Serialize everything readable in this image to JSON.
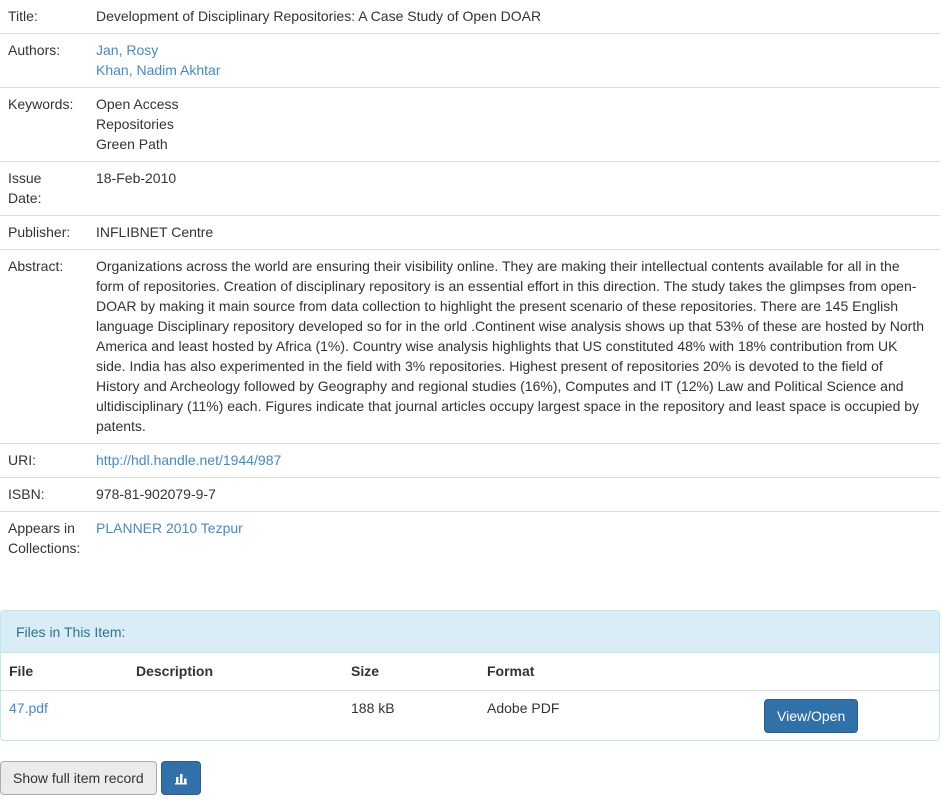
{
  "metadata": {
    "title_label": "Title:",
    "title": "Development of Disciplinary Repositories: A Case Study of Open DOAR",
    "authors_label": "Authors:",
    "authors": [
      "Jan, Rosy",
      "Khan, Nadim Akhtar"
    ],
    "keywords_label": "Keywords:",
    "keywords": [
      "Open Access",
      "Repositories",
      "Green Path"
    ],
    "issue_date_label": [
      "Issue",
      "Date:"
    ],
    "issue_date": "18-Feb-2010",
    "publisher_label": "Publisher:",
    "publisher": "INFLIBNET Centre",
    "abstract_label": "Abstract:",
    "abstract": "Organizations across the world are ensuring their visibility online. They are making their intellectual contents available for all in the form of repositories. Creation of disciplinary repository is an essential effort in this direction. The study takes the glimpses from open-DOAR by making it main source from data collection to highlight the present scenario of these repositories. There are 145 English language Disciplinary repository developed so for in the orld .Continent wise analysis shows up that 53% of these are hosted by North America and least hosted by Africa (1%). Country wise analysis highlights that US constituted 48% with 18% contribution from UK side. India has also experimented in the field with 3% repositories. Highest present of repositories 20% is devoted to the field of History and Archeology followed by Geography and regional studies (16%), Computes and IT (12%) Law and Political Science and ultidisciplinary (11%) each. Figures indicate that journal articles occupy largest space in the repository and least space is occupied by patents.",
    "uri_label": "URI:",
    "uri": "http://hdl.handle.net/1944/987",
    "isbn_label": "ISBN:",
    "isbn": "978-81-902079-9-7",
    "collections_label": [
      "Appears in",
      "Collections:"
    ],
    "collection": "PLANNER 2010 Tezpur"
  },
  "files_panel": {
    "heading": "Files in This Item:",
    "columns": [
      "File",
      "Description",
      "Size",
      "Format"
    ],
    "rows": [
      {
        "file": "47.pdf",
        "description": "",
        "size": "188 kB",
        "format": "Adobe PDF",
        "action": "View/Open"
      }
    ]
  },
  "actions": {
    "full_record_label": "Show full item record",
    "stats_icon": "bar-chart-icon"
  },
  "colors": {
    "link": "#428bca",
    "panel_heading_bg": "#d9edf7",
    "panel_heading_text": "#31708f",
    "primary_button": "#3071a9"
  }
}
